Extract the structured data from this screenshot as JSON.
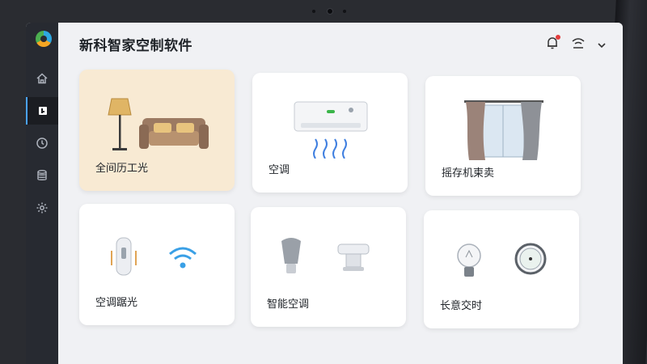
{
  "app": {
    "title": "新科智家空制软件"
  },
  "sidebar": {
    "items": [
      {
        "name": "home",
        "icon": "home-icon"
      },
      {
        "name": "devices",
        "icon": "device-icon",
        "active": true
      },
      {
        "name": "history",
        "icon": "clock-icon"
      },
      {
        "name": "data",
        "icon": "database-icon"
      },
      {
        "name": "settings",
        "icon": "gear-icon"
      }
    ]
  },
  "header": {
    "notification_icon": "bell-icon",
    "network_icon": "wifi-icon",
    "menu_icon": "chevron-down-icon"
  },
  "cards": [
    {
      "label": "全间历工光",
      "icon": "lamp-sofa-icon",
      "highlight": true
    },
    {
      "label": "空调",
      "icon": "air-conditioner-icon"
    },
    {
      "label": "摇存机柬卖",
      "icon": "curtain-icon"
    },
    {
      "label": "空调踞光",
      "icon": "sensor-wifi-icon"
    },
    {
      "label": "智能空调",
      "icon": "bulb-device-icon"
    },
    {
      "label": "长意交时",
      "icon": "bulb-compass-icon"
    }
  ],
  "colors": {
    "accent": "#4aa3ff",
    "sidebar": "#272a31",
    "highlight_card": "#f8ead3",
    "notification_dot": "#e33d3d"
  }
}
